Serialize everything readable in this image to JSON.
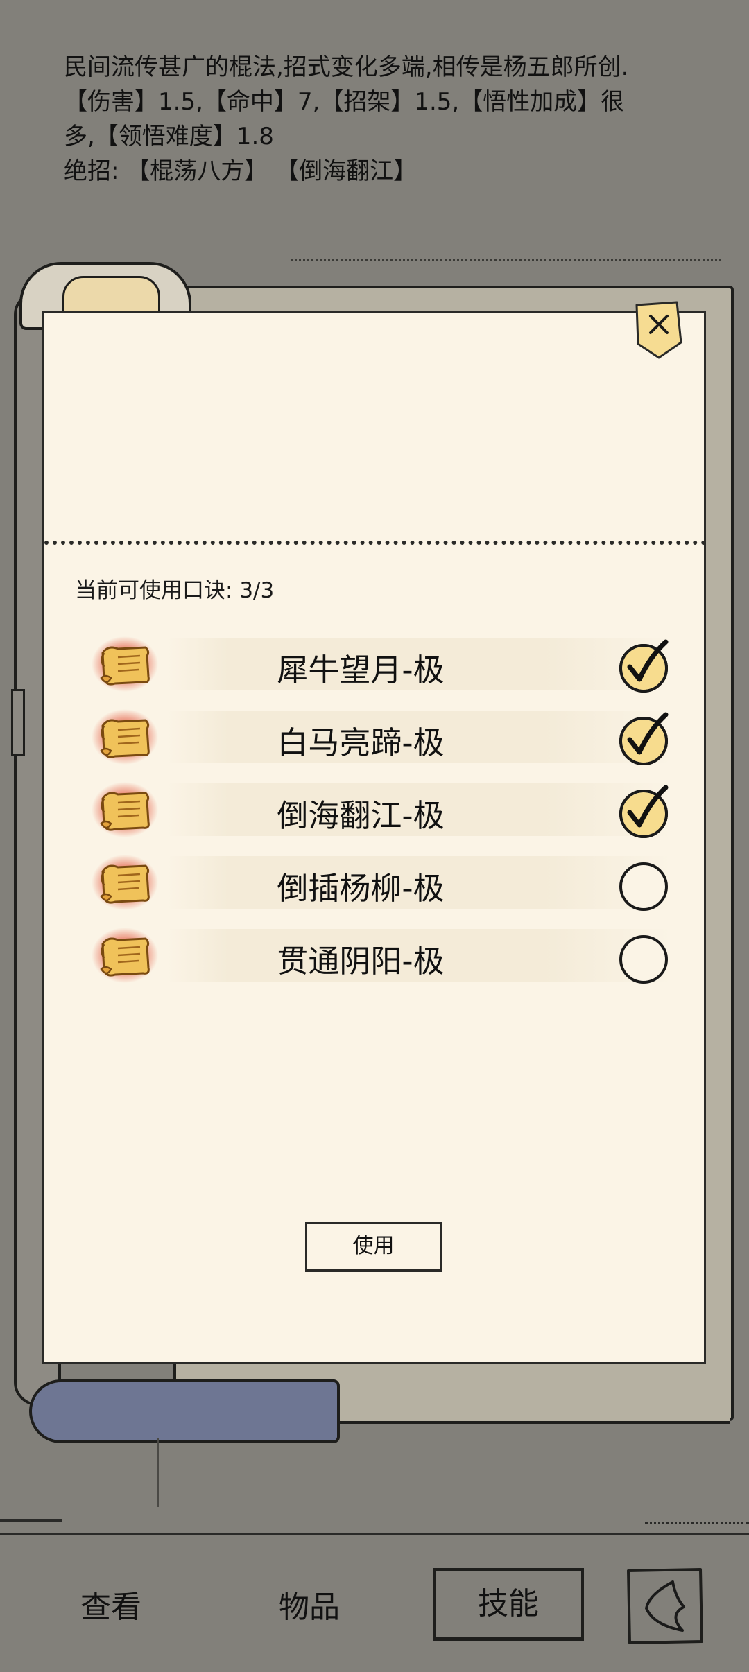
{
  "description": {
    "lines": [
      "民间流传甚广的棍法,招式变化多端,相传是杨五郎所创.",
      "【伤害】1.5,【命中】7,【招架】1.5,【悟性加成】很",
      "多,【领悟难度】1.8",
      "绝招: 【棍荡八方】 【倒海翻江】"
    ]
  },
  "dialog": {
    "available_label": "当前可使用口诀:",
    "available_count": "3/3",
    "skills": [
      {
        "name": "犀牛望月-极",
        "checked": true,
        "icon": "scroll-icon"
      },
      {
        "name": "白马亮蹄-极",
        "checked": true,
        "icon": "scroll-icon"
      },
      {
        "name": "倒海翻江-极",
        "checked": true,
        "icon": "scroll-icon"
      },
      {
        "name": "倒插杨柳-极",
        "checked": false,
        "icon": "scroll-icon"
      },
      {
        "name": "贯通阴阳-极",
        "checked": false,
        "icon": "scroll-icon"
      }
    ],
    "use_button": "使用",
    "close_icon": "close-icon"
  },
  "nav": {
    "view": "查看",
    "items": "物品",
    "skills": "技能",
    "back_icon": "back-arrow-icon"
  },
  "colors": {
    "background": "#82807a",
    "panel": "#fbf4e6",
    "scroll_gold": "#f0c25a",
    "scroll_glow": "#e0452a",
    "check_fill": "#f7dc8e"
  }
}
